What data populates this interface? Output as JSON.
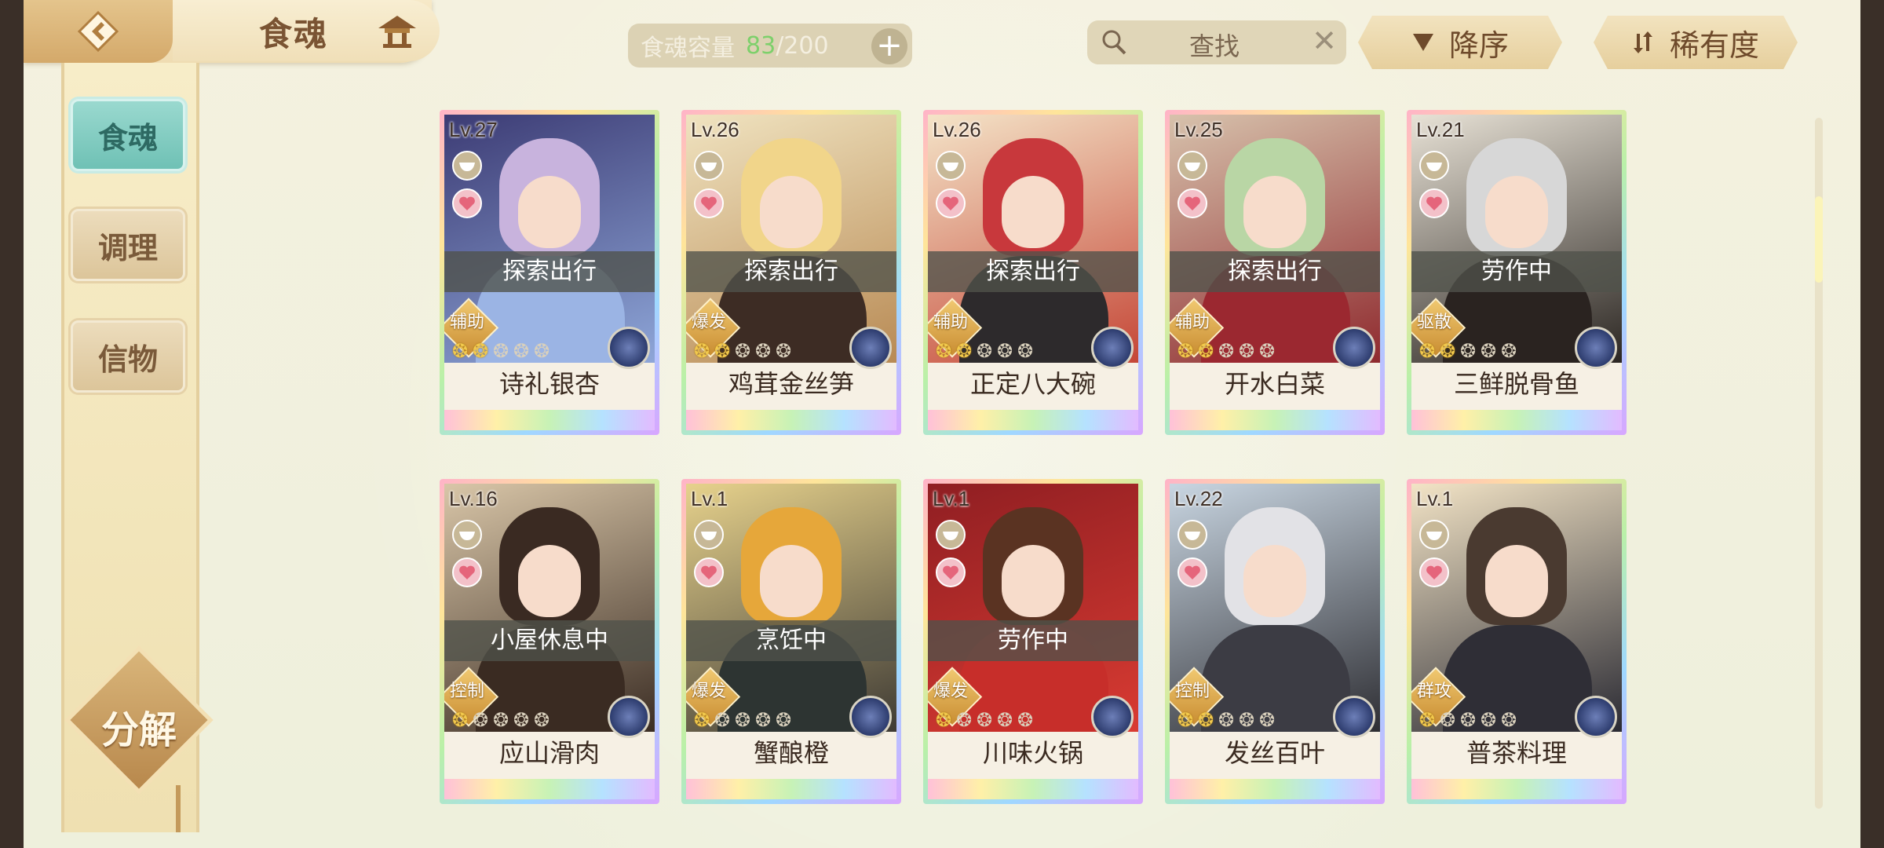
{
  "header": {
    "title": "食魂",
    "capacity_label": "食魂容量",
    "capacity_current": "83",
    "capacity_max": "/200",
    "capacity_plus": "+",
    "search_label": "查找",
    "search_clear": "✕",
    "sort_desc_label": "降序",
    "sort_rarity_label": "稀有度"
  },
  "sidebar": {
    "items": [
      {
        "label": "食魂"
      },
      {
        "label": "调理"
      },
      {
        "label": "信物"
      }
    ],
    "decompose_label": "分解"
  },
  "colors": {
    "accent_teal": "#7ccabf",
    "gold": "#d4a96a",
    "capacity_green": "#7dd06b"
  },
  "cards": [
    {
      "level": "Lv.27",
      "status": "探索出行",
      "role": "辅助",
      "stars_on": 2,
      "name": "诗礼银杏",
      "c1": "#3c3b74",
      "c2": "#8ea6d8",
      "hair": "#c8b3dd",
      "cloth": "#9bb4e4"
    },
    {
      "level": "Lv.26",
      "status": "探索出行",
      "role": "爆发",
      "stars_on": 2,
      "name": "鸡茸金丝笋",
      "c1": "#f0e3c0",
      "c2": "#b88a54",
      "hair": "#f1d58a",
      "cloth": "#3d2c24"
    },
    {
      "level": "Lv.26",
      "status": "探索出行",
      "role": "辅助",
      "stars_on": 2,
      "name": "正定八大碗",
      "c1": "#f4e4c8",
      "c2": "#c54636",
      "hair": "#c8383c",
      "cloth": "#2d2a2c"
    },
    {
      "level": "Lv.25",
      "status": "探索出行",
      "role": "辅助",
      "stars_on": 2,
      "name": "开水白菜",
      "c1": "#d7c2ac",
      "c2": "#8f2a2e",
      "hair": "#b9d6a5",
      "cloth": "#9b2830"
    },
    {
      "level": "Lv.21",
      "status": "劳作中",
      "role": "驱散",
      "stars_on": 2,
      "name": "三鲜脱骨鱼",
      "c1": "#e8e2d6",
      "c2": "#2b2622",
      "hair": "#d7d7d7",
      "cloth": "#2a2320"
    },
    {
      "level": "Lv.16",
      "status": "小屋休息中",
      "role": "控制",
      "stars_on": 1,
      "name": "应山滑肉",
      "c1": "#d9c6a8",
      "c2": "#3b2d24",
      "hair": "#3a2a22",
      "cloth": "#3a2b22"
    },
    {
      "level": "Lv.1",
      "status": "烹饪中",
      "role": "爆发",
      "stars_on": 1,
      "name": "蟹酿橙",
      "c1": "#e7d28c",
      "c2": "#3e3a34",
      "hair": "#e6a73a",
      "cloth": "#2d3432"
    },
    {
      "level": "Lv.1",
      "status": "劳作中",
      "role": "爆发",
      "stars_on": 1,
      "name": "川味火锅",
      "c1": "#8f1e22",
      "c2": "#d93b32",
      "hair": "#5a3322",
      "cloth": "#c72e2a"
    },
    {
      "level": "Lv.22",
      "status": "",
      "role": "控制",
      "stars_on": 2,
      "name": "发丝百叶",
      "c1": "#c9d6e2",
      "c2": "#2e2e33",
      "hair": "#e2e2e6",
      "cloth": "#3c3c44"
    },
    {
      "level": "Lv.1",
      "status": "",
      "role": "群攻",
      "stars_on": 1,
      "name": "普茶料理",
      "c1": "#f3e4c6",
      "c2": "#2a2a33",
      "hair": "#4a3a30",
      "cloth": "#2f2e36"
    }
  ]
}
